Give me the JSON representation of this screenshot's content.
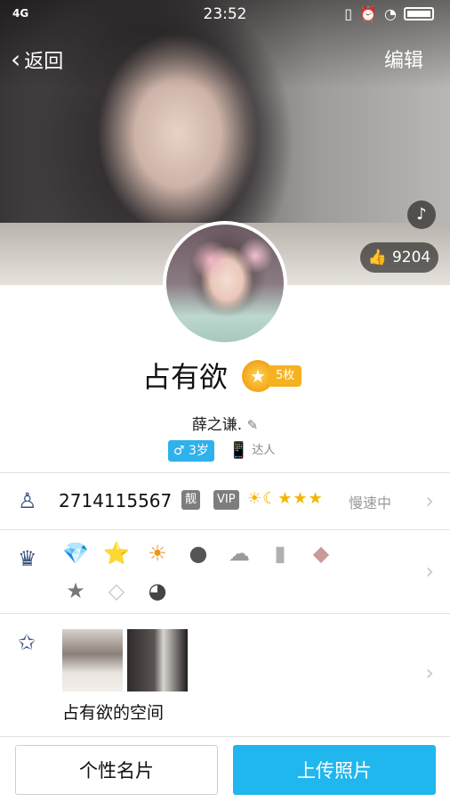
{
  "status": {
    "network": "4G",
    "time": "23:52"
  },
  "nav": {
    "back_label": "返回",
    "edit_label": "编辑"
  },
  "cover": {
    "likes": "9204"
  },
  "profile": {
    "name": "占有欲",
    "coins": "5枚",
    "signature": "薛之谦.",
    "age_badge": "3岁",
    "daren_badge": "达人"
  },
  "qq_row": {
    "qq_number": "2714115567",
    "tag_liang": "靓",
    "tag_vip": "VIP",
    "status": "慢速中"
  },
  "badges_row": {
    "items": [
      {
        "icon": "gold-diamond-lv2-icon",
        "glyph": "💎"
      },
      {
        "icon": "green-star-lv2-icon",
        "glyph": "⭐"
      },
      {
        "icon": "orange-sun-lv2-icon",
        "glyph": "☀"
      },
      {
        "icon": "penguin-icon",
        "glyph": "●"
      },
      {
        "icon": "cloud-icon",
        "glyph": "☁"
      },
      {
        "icon": "book-icon",
        "glyph": "▮"
      },
      {
        "icon": "pink-diamond-icon",
        "glyph": "◆"
      },
      {
        "icon": "grey-star-icon",
        "glyph": "★"
      },
      {
        "icon": "pale-diamond-icon",
        "glyph": "◇"
      },
      {
        "icon": "penguin-face-icon",
        "glyph": "◕"
      }
    ]
  },
  "space_row": {
    "label": "占有欲的空间"
  },
  "buttons": {
    "card": "个性名片",
    "upload": "上传照片"
  },
  "colors": {
    "accent": "#20b6ee",
    "gold": "#f6b21e",
    "icon": "#36507a"
  }
}
